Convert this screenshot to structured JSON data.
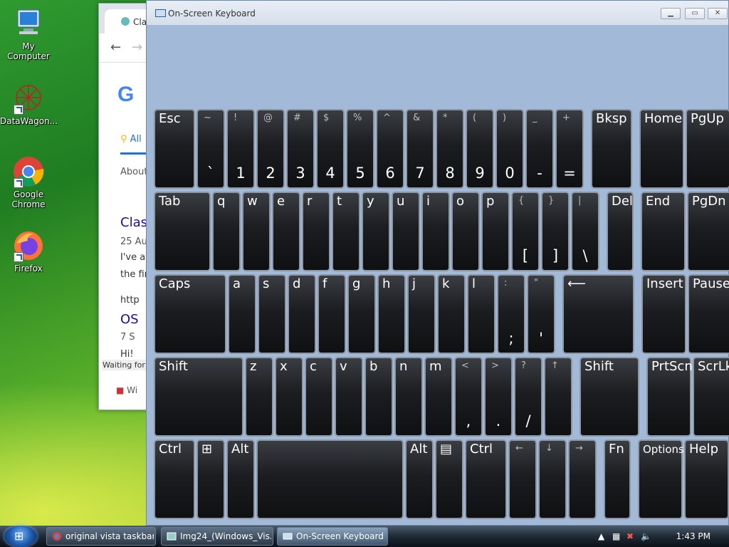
{
  "desktop": {
    "icons": [
      {
        "label": "My Computer"
      },
      {
        "label": "DataWagon..."
      },
      {
        "label": "Google Chrome"
      },
      {
        "label": "Firefox"
      }
    ]
  },
  "browser": {
    "tab_title": "Clas",
    "about": "About",
    "all_tab": "All",
    "result_title": "Clas",
    "date": "25 Au",
    "snippet1": "I've al",
    "snippet2": "the fin",
    "url_frag": "http",
    "link2": "OS",
    "line7": "7 S",
    "hi": "Hi!",
    "status": "Waiting for w",
    "bottom": "Wi"
  },
  "osk": {
    "title": "On-Screen Keyboard",
    "rows": [
      [
        {
          "top": "",
          "label": "Esc"
        },
        {
          "top": "~",
          "main": "`"
        },
        {
          "top": "!",
          "main": "1"
        },
        {
          "top": "@",
          "main": "2"
        },
        {
          "top": "#",
          "main": "3"
        },
        {
          "top": "$",
          "main": "4"
        },
        {
          "top": "%",
          "main": "5"
        },
        {
          "top": "^",
          "main": "6"
        },
        {
          "top": "&",
          "main": "7"
        },
        {
          "top": "*",
          "main": "8"
        },
        {
          "top": "(",
          "main": "9"
        },
        {
          "top": ")",
          "main": "0"
        },
        {
          "top": "_",
          "main": "-"
        },
        {
          "top": "+",
          "main": "="
        },
        {
          "label": "Bksp"
        },
        {
          "label": "Home"
        },
        {
          "label": "PgUp"
        }
      ],
      [
        {
          "label": "Tab"
        },
        {
          "label": "q"
        },
        {
          "label": "w"
        },
        {
          "label": "e"
        },
        {
          "label": "r"
        },
        {
          "label": "t"
        },
        {
          "label": "y"
        },
        {
          "label": "u"
        },
        {
          "label": "i"
        },
        {
          "label": "o"
        },
        {
          "label": "p"
        },
        {
          "top": "{",
          "main": "["
        },
        {
          "top": "}",
          "main": "]"
        },
        {
          "top": "|",
          "main": "\\"
        },
        {
          "label": "Del"
        },
        {
          "label": "End"
        },
        {
          "label": "PgDn"
        }
      ],
      [
        {
          "label": "Caps"
        },
        {
          "label": "a"
        },
        {
          "label": "s"
        },
        {
          "label": "d"
        },
        {
          "label": "f"
        },
        {
          "label": "g"
        },
        {
          "label": "h"
        },
        {
          "label": "j"
        },
        {
          "label": "k"
        },
        {
          "label": "l"
        },
        {
          "top": ":",
          "main": ";"
        },
        {
          "top": "\"",
          "main": "'"
        },
        {
          "label": "⟵"
        },
        {
          "label": "Insert"
        },
        {
          "label": "Pause"
        }
      ],
      [
        {
          "label": "Shift"
        },
        {
          "label": "z"
        },
        {
          "label": "x"
        },
        {
          "label": "c"
        },
        {
          "label": "v"
        },
        {
          "label": "b"
        },
        {
          "label": "n"
        },
        {
          "label": "m"
        },
        {
          "top": "<",
          "main": ","
        },
        {
          "top": ">",
          "main": "."
        },
        {
          "top": "?",
          "main": "/"
        },
        {
          "top": "↑",
          "main": ""
        },
        {
          "label": "Shift"
        },
        {
          "label": "PrtScn"
        },
        {
          "label": "ScrLk"
        }
      ],
      [
        {
          "label": "Ctrl"
        },
        {
          "label": "⊞"
        },
        {
          "label": "Alt"
        },
        {
          "label": ""
        },
        {
          "label": "Alt"
        },
        {
          "label": "▤"
        },
        {
          "label": "Ctrl"
        },
        {
          "top": "←",
          "main": ""
        },
        {
          "top": "↓",
          "main": ""
        },
        {
          "top": "→",
          "main": ""
        },
        {
          "label": "Fn"
        },
        {
          "label": "Options"
        },
        {
          "label": "Help"
        }
      ]
    ]
  },
  "taskbar": {
    "items": [
      {
        "label": "original vista taskbar ..."
      },
      {
        "label": "Img24_(Windows_Vis..."
      },
      {
        "label": "On-Screen Keyboard"
      }
    ],
    "clock": "1:43 PM"
  }
}
